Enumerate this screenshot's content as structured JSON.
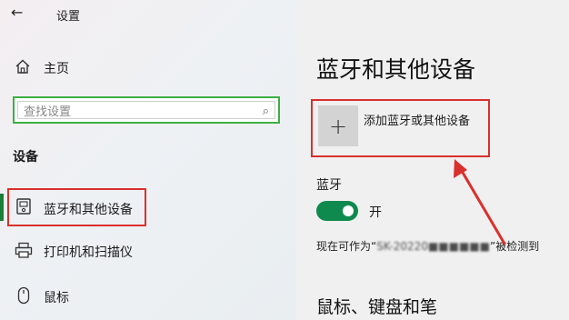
{
  "window": {
    "back_glyph": "←",
    "title": "设置"
  },
  "sidebar": {
    "home_label": "主页",
    "search": {
      "placeholder": "查找设置"
    },
    "section_heading": "设备",
    "items": [
      {
        "label": "蓝牙和其他设备",
        "icon": "bluetooth-devices-icon",
        "selected": true
      },
      {
        "label": "打印机和扫描仪",
        "icon": "printer-icon",
        "selected": false
      },
      {
        "label": "鼠标",
        "icon": "mouse-icon",
        "selected": false
      }
    ]
  },
  "main": {
    "title": "蓝牙和其他设备",
    "add_device": {
      "plus": "+",
      "label": "添加蓝牙或其他设备"
    },
    "bluetooth": {
      "label": "蓝牙",
      "toggle_on": true,
      "state_text": "开"
    },
    "discoverable": {
      "prefix": "现在可作为“",
      "device_name": "SK-20220■■■■■■",
      "suffix": "”被检测到"
    },
    "sub_heading": "鼠标、键盘和笔"
  },
  "colors": {
    "accent_green": "#0f8a4e",
    "highlight_red": "#d9302c",
    "search_border": "#3cb043"
  }
}
